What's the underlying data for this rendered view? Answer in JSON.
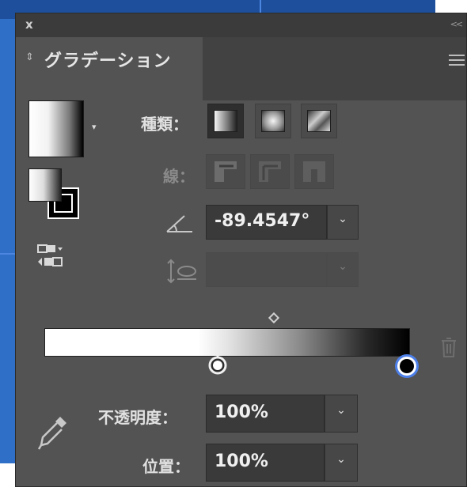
{
  "window": {
    "close_label": "x",
    "collapse_label": "<<"
  },
  "tab": {
    "updown_label": "⇕",
    "title": "グラデーション"
  },
  "type": {
    "label": "種類："
  },
  "stroke": {
    "label": "線："
  },
  "angle": {
    "value": "-89.4547°",
    "dropdown": "⌄"
  },
  "aspect": {
    "value": "",
    "dropdown": "⌄"
  },
  "opacity": {
    "label": "不透明度：",
    "value": "100%",
    "dropdown": "⌄"
  },
  "location": {
    "label": "位置：",
    "value": "100%",
    "dropdown": "⌄"
  },
  "icons": {
    "swatch_dropdown": "▾",
    "swap": "swap-gradient-icon",
    "angle": "angle-icon",
    "aspect": "aspect-ratio-icon",
    "delete": "trash-icon",
    "eyedropper": "eyedropper-icon"
  },
  "colors": {
    "panel_bg": "#535353",
    "field_bg": "#3a3a3a",
    "selected_stop": "#3a6fe0",
    "canvas_blue": "#2f6fc8"
  }
}
